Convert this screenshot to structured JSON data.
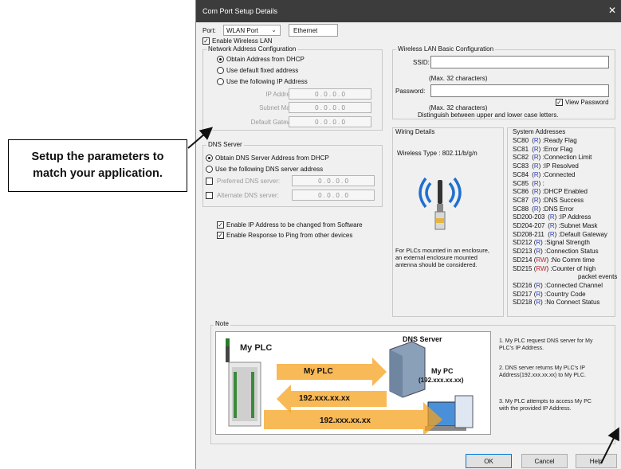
{
  "callout": {
    "line1": "Setup the parameters to",
    "line2": "match your application."
  },
  "dialog": {
    "title": "Com Port Setup Details",
    "close_glyph": "✕",
    "port_label": "Port:",
    "port_value": "WLAN Port",
    "ethernet_tab": "Ethernet",
    "enable_wireless": "Enable Wireless LAN",
    "network": {
      "title": "Network Address Configuration",
      "opt_dhcp": "Obtain Address from DHCP",
      "opt_default": "Use default fixed address",
      "opt_following": "Use the following IP Address",
      "ip_label": "IP Address:",
      "mask_label": "Subnet Mask:",
      "gateway_label": "Default Gateway:",
      "ip_value": "0 . 0 . 0 . 0"
    },
    "dns": {
      "title": "DNS Server",
      "opt_auto": "Obtain DNS Server Address from DHCP",
      "opt_manual": "Use the following DNS server address",
      "preferred_label": "Preferred DNS server:",
      "alternate_label": "Alternate DNS server:",
      "value": "0 . 0 . 0 . 0"
    },
    "enable_ip_change": "Enable IP Address to be changed from Software",
    "enable_ping": "Enable Response to Ping from other devices",
    "wlan": {
      "title": "Wireless LAN Basic Configuration",
      "ssid_label": "SSID:",
      "ssid_hint": "(Max. 32 characters)",
      "password_label": "Password:",
      "view_password": "View Password",
      "password_hint1": "(Max. 32 characters)",
      "password_hint2": "Distinguish between upper and lower case letters."
    },
    "wiring": {
      "title": "Wiring Details",
      "wireless_type": "Wireless Type : 802.11/b/g/n",
      "enclosure_note": [
        "For PLCs mounted in an enclosure,",
        "an external enclosure mounted",
        "antenna should be considered."
      ]
    },
    "system": {
      "title": "System Addresses",
      "lines": [
        {
          "addr": "SC80",
          "acc": "R",
          "desc": ":Ready Flag"
        },
        {
          "addr": "SC81",
          "acc": "R",
          "desc": ":Error Flag"
        },
        {
          "addr": "SC82",
          "acc": "R",
          "desc": ":Connection Limit"
        },
        {
          "addr": "SC83",
          "acc": "R",
          "desc": ":IP Resolved"
        },
        {
          "addr": "SC84",
          "acc": "R",
          "desc": ":Connected"
        },
        {
          "addr": "SC85",
          "acc": "R",
          "desc": ":"
        },
        {
          "addr": "SC86",
          "acc": "R",
          "desc": ":DHCP Enabled"
        },
        {
          "addr": "SC87",
          "acc": "R",
          "desc": ":DNS Success"
        },
        {
          "addr": "SC88",
          "acc": "R",
          "desc": ":DNS Error"
        },
        {
          "addr": "SD200-203",
          "acc": "R",
          "desc": ":IP Address"
        },
        {
          "addr": "SD204-207",
          "acc": "R",
          "desc": ":Subnet Mask"
        },
        {
          "addr": "SD208-211",
          "acc": "R",
          "desc": ":Default Gateway"
        },
        {
          "addr": "SD212",
          "acc": "R",
          "desc": ":Signal Strength"
        },
        {
          "addr": "SD213",
          "acc": "R",
          "desc": ":Connection Status"
        },
        {
          "addr": "SD214",
          "acc": "RW",
          "desc": ":No Comm time"
        },
        {
          "addr": "SD215",
          "acc": "RW",
          "desc": ":Counter of high"
        },
        {
          "addr": "",
          "acc": "",
          "desc": "packet events"
        },
        {
          "addr": "SD216",
          "acc": "R",
          "desc": ":Connected Channel"
        },
        {
          "addr": "SD217",
          "acc": "R",
          "desc": ":Country Code"
        },
        {
          "addr": "SD218",
          "acc": "R",
          "desc": ":No Connect Status"
        }
      ]
    },
    "note": {
      "title": "Note",
      "my_plc": "My PLC",
      "dns_server": "DNS Server",
      "my_pc": "My PC",
      "my_pc_ip": "(192.xxx.xx.xx)",
      "arrow1": "My PLC",
      "arrow2": "192.xxx.xx.xx",
      "arrow3": "192.xxx.xx.xx",
      "step1": "1. My PLC request DNS server for My PLC's IP Address.",
      "step2": "2. DNS server returns My PLC's IP Address(192.xxx.xx.xx) to My PLC.",
      "step3": "3. My PLC attempts to access My PC with the provided IP Address."
    },
    "buttons": {
      "ok": "OK",
      "cancel": "Cancel",
      "help": "Help"
    }
  },
  "colors": {
    "arrow_orange": "#f5a21f",
    "title_bar": "#3c3c3c",
    "read": "#2b3fbf",
    "read_write": "#c0262d"
  }
}
